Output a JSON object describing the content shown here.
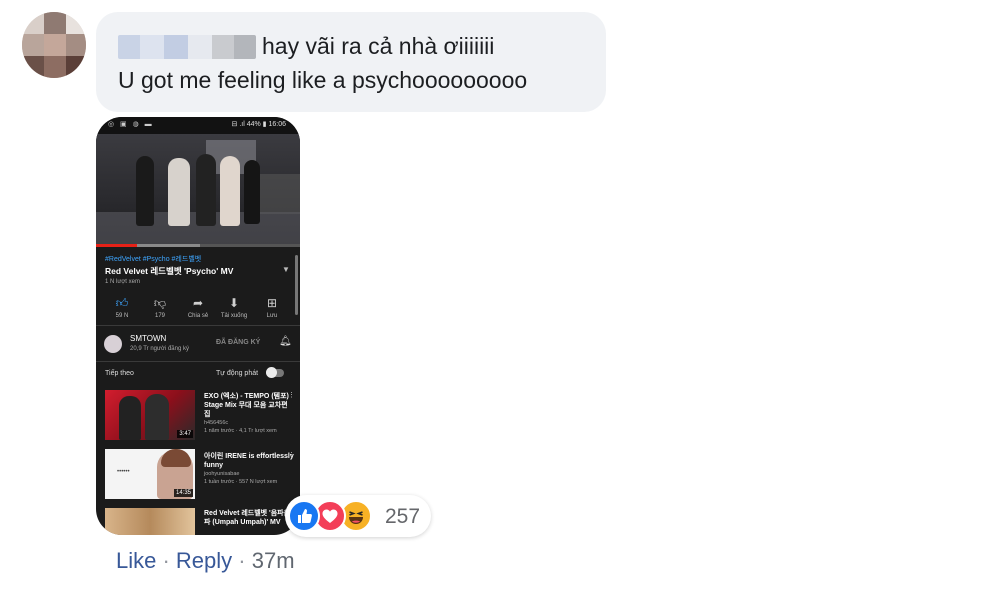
{
  "comment": {
    "line1": "hay vãi ra cả nhà ơiiiiiii",
    "line2": "U got me feeling like a psychooooooooo"
  },
  "phone": {
    "status_left": "◎ ▣ ◍ ▬",
    "status_right": "⊟ .ıl 44% ▮ 16:06",
    "video": {
      "hashtags": "#RedVelvet #Psycho #레드벨벳",
      "title": "Red Velvet 레드벨벳 'Psycho' MV",
      "views": "1 N lượt xem",
      "progress": 0.2,
      "buffered": 0.51
    },
    "actions": [
      {
        "icon": "thumbs-up-icon",
        "label": "59 N"
      },
      {
        "icon": "thumbs-down-icon",
        "label": "179"
      },
      {
        "icon": "share-icon",
        "label": "Chia sẻ"
      },
      {
        "icon": "download-icon",
        "label": "Tải xuống"
      },
      {
        "icon": "save-icon",
        "label": "Lưu"
      }
    ],
    "channel": {
      "name": "SMTOWN",
      "subs": "20,9 Tr người đăng ký",
      "subscribed_label": "ĐÃ ĐĂNG KÝ"
    },
    "up_next": "Tiếp theo",
    "autoplay": "Tự động phát",
    "related": [
      {
        "title": "EXO (엑소) - TEMPO (템포) Stage Mix 무대 모음 교차편집",
        "channel": "h456456c",
        "meta": "1 năm trước · 4,1 Tr lượt xem",
        "duration": "3:47"
      },
      {
        "title": "아이린 IRENE is effortlessly funny",
        "channel": "joohyunisabae",
        "meta": "1 tuần trước · 557 N lượt xem",
        "duration": "14:35"
      },
      {
        "title": "Red Velvet 레드벨벳 '음파음파 (Umpah Umpah)' MV",
        "channel": "",
        "meta": "",
        "duration": ""
      }
    ],
    "thumb2_text": "••••••"
  },
  "reactions": {
    "types": [
      "like",
      "love",
      "haha"
    ],
    "count": "257"
  },
  "footer": {
    "like": "Like",
    "separator": " · ",
    "reply": "Reply",
    "time": "37m"
  }
}
